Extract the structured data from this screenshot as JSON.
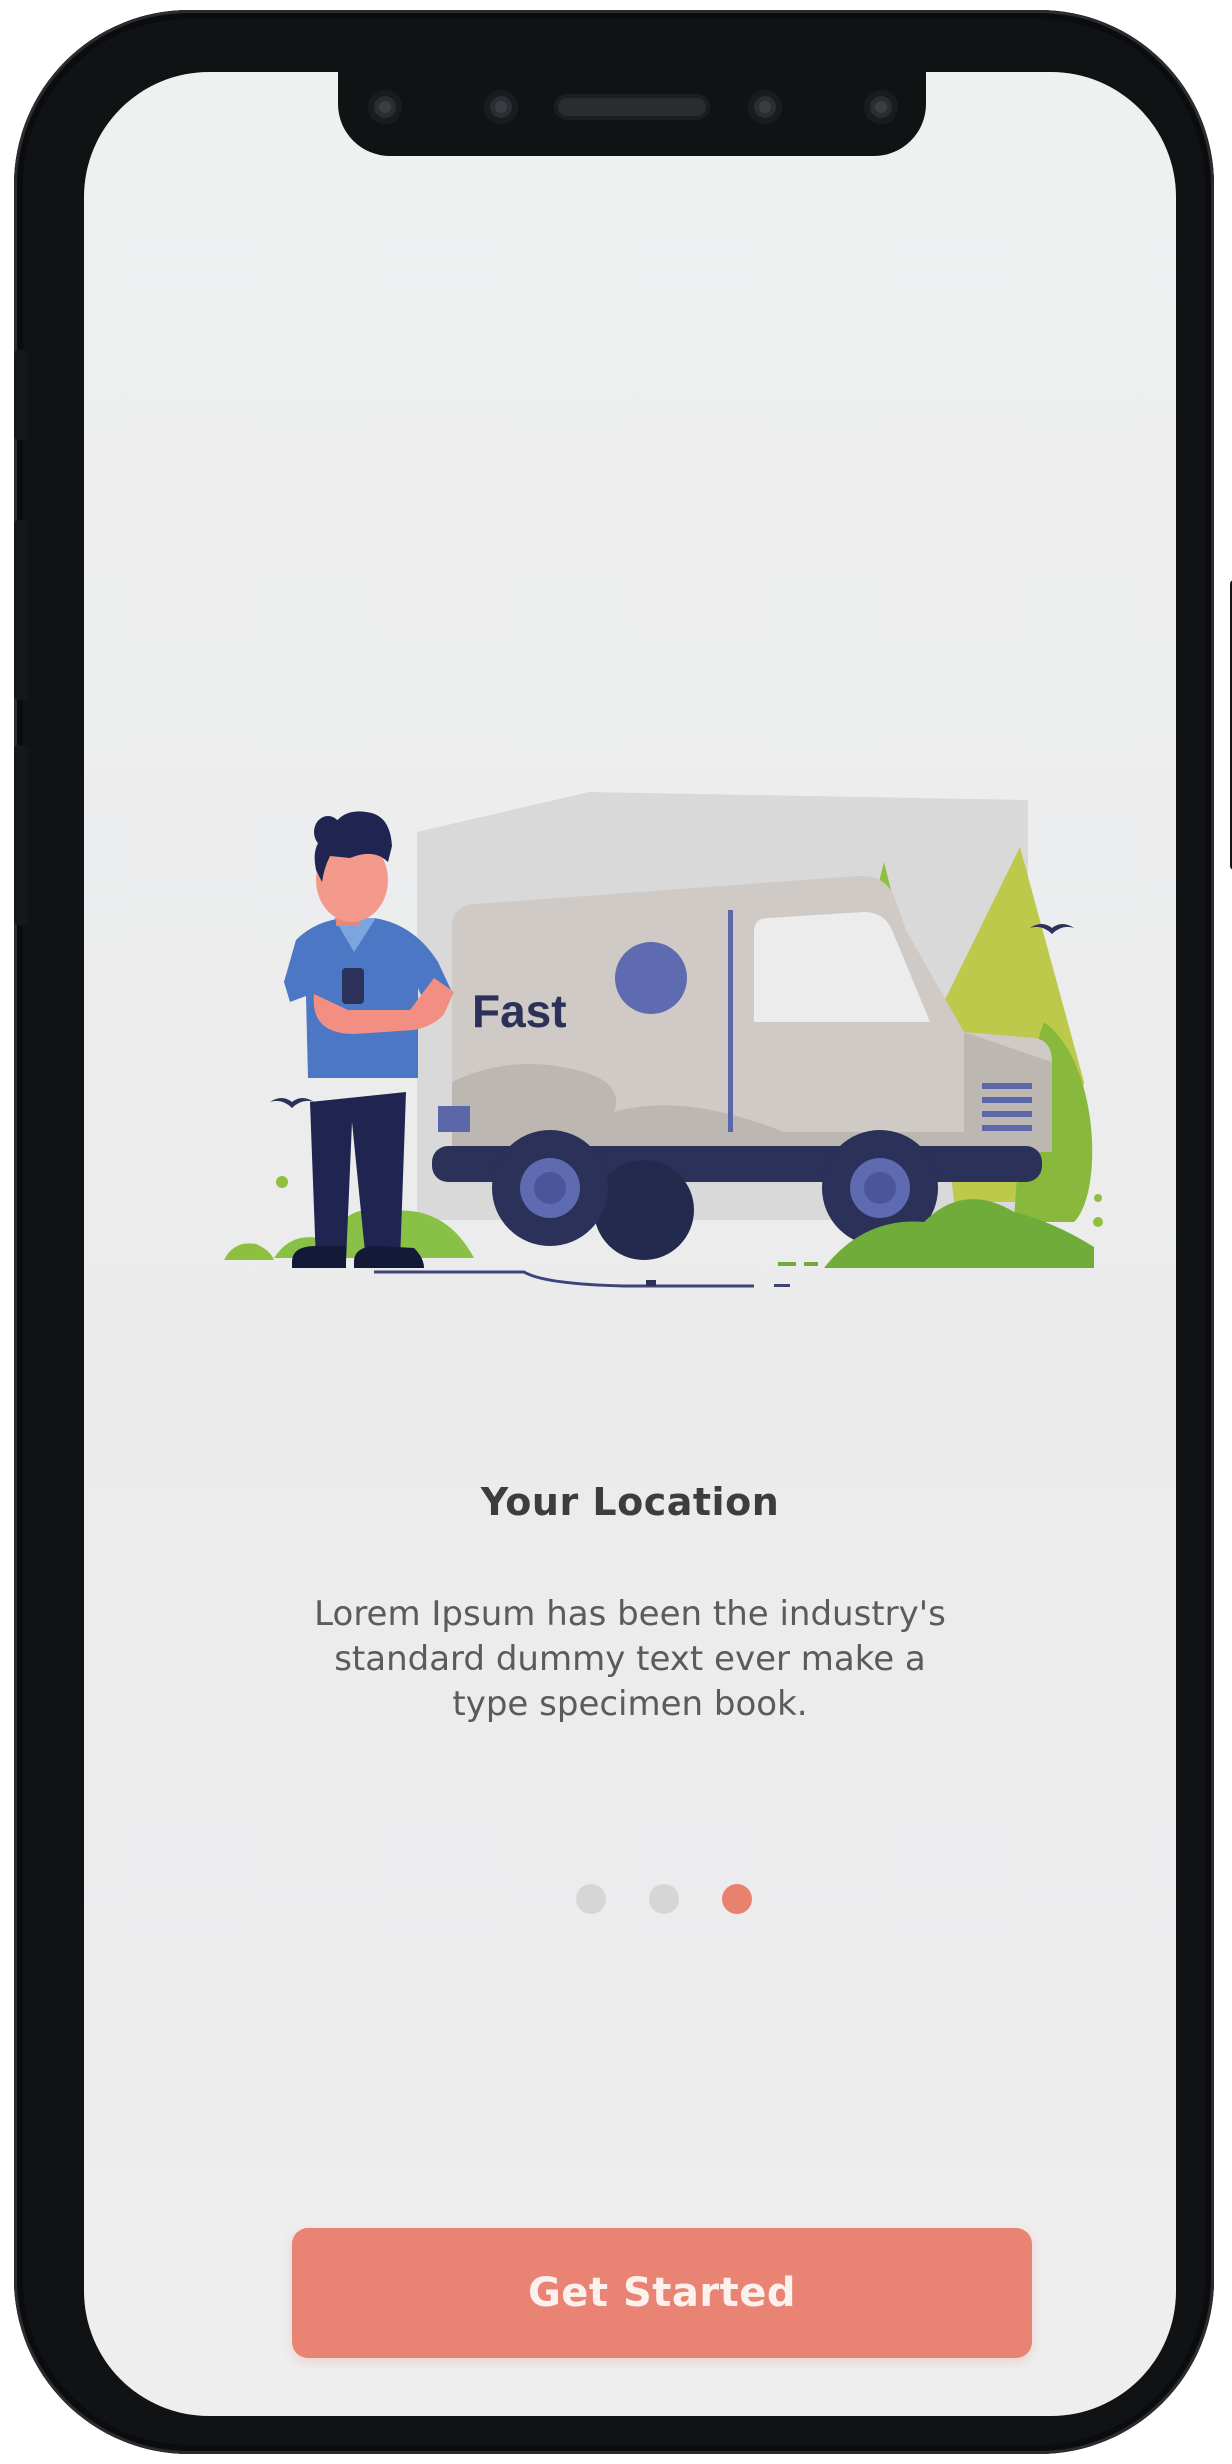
{
  "onboarding": {
    "illustration": {
      "truck_text": "Fast"
    },
    "title": "Your Location",
    "description": "Lorem Ipsum has been the industry's standard dummy text ever make a type specimen book.",
    "pager": {
      "total": 3,
      "active_index": 3
    },
    "cta_label": "Get Started"
  },
  "colors": {
    "accent": "#e98474",
    "dot_inactive": "#d6d6d6",
    "title_text": "#3d3d3d",
    "body_text": "#5b5b5b",
    "truck_navy": "#2b3158",
    "foliage_green": "#8fbf3f"
  }
}
